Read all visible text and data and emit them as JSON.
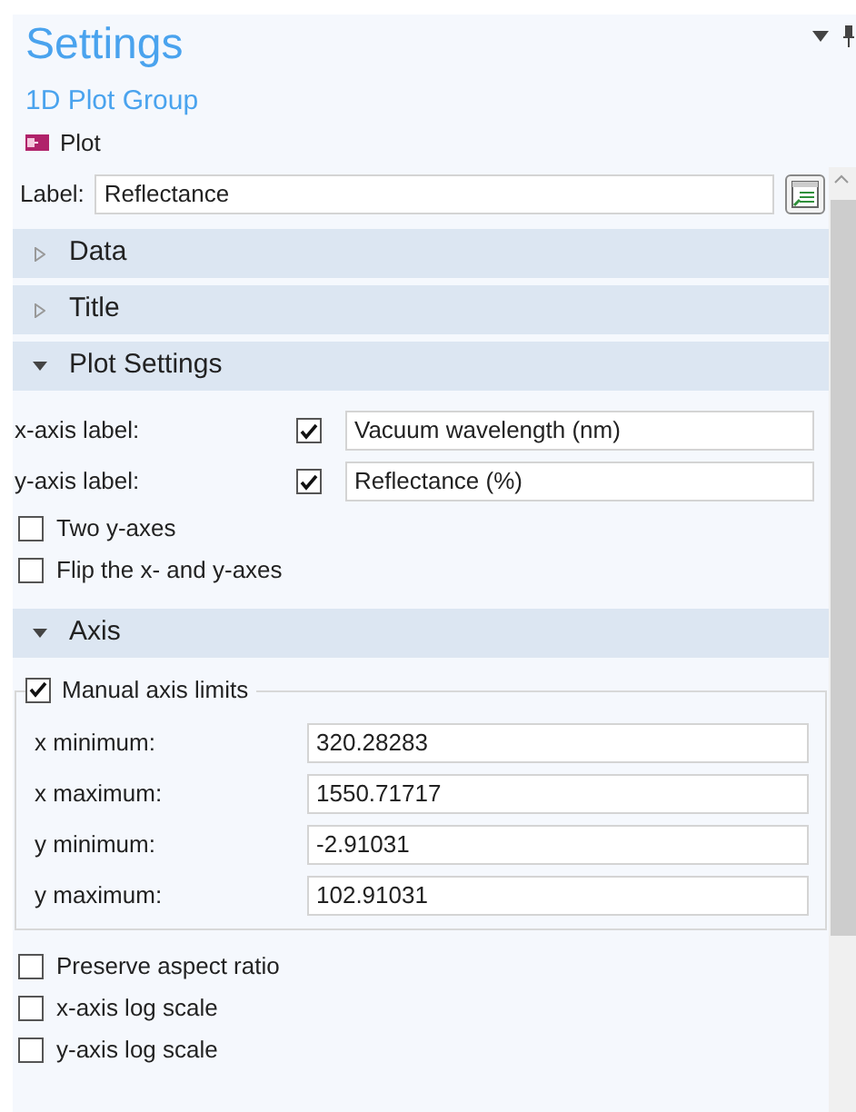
{
  "panel": {
    "title": "Settings",
    "subtitle": "1D Plot Group",
    "node": "Plot"
  },
  "label_field": {
    "label": "Label:",
    "value": "Reflectance"
  },
  "sections": [
    {
      "title": "Data",
      "expanded": false
    },
    {
      "title": "Title",
      "expanded": false
    },
    {
      "title": "Plot Settings",
      "expanded": true,
      "items": [
        {
          "kind": "labeled_check",
          "label": "x-axis label:",
          "checked": true,
          "value": "Vacuum wavelength (nm)"
        },
        {
          "kind": "labeled_check",
          "label": "y-axis label:",
          "checked": true,
          "value": "Reflectance (%)"
        },
        {
          "kind": "check",
          "label": "Two y-axes",
          "checked": false
        },
        {
          "kind": "check",
          "label": "Flip the x- and y-axes",
          "checked": false
        }
      ]
    },
    {
      "title": "Axis",
      "expanded": true,
      "items": [
        {
          "kind": "group",
          "label": "Manual axis limits",
          "checked": true,
          "fields": [
            {
              "label": "x minimum:",
              "value": "320.28283"
            },
            {
              "label": "x maximum:",
              "value": "1550.71717"
            },
            {
              "label": "y minimum:",
              "value": "-2.91031"
            },
            {
              "label": "y maximum:",
              "value": "102.91031"
            }
          ]
        },
        {
          "kind": "check",
          "label": "Preserve aspect ratio",
          "checked": false
        },
        {
          "kind": "check",
          "label": "x-axis log scale",
          "checked": false
        },
        {
          "kind": "check",
          "label": "y-axis log scale",
          "checked": false
        }
      ]
    }
  ]
}
